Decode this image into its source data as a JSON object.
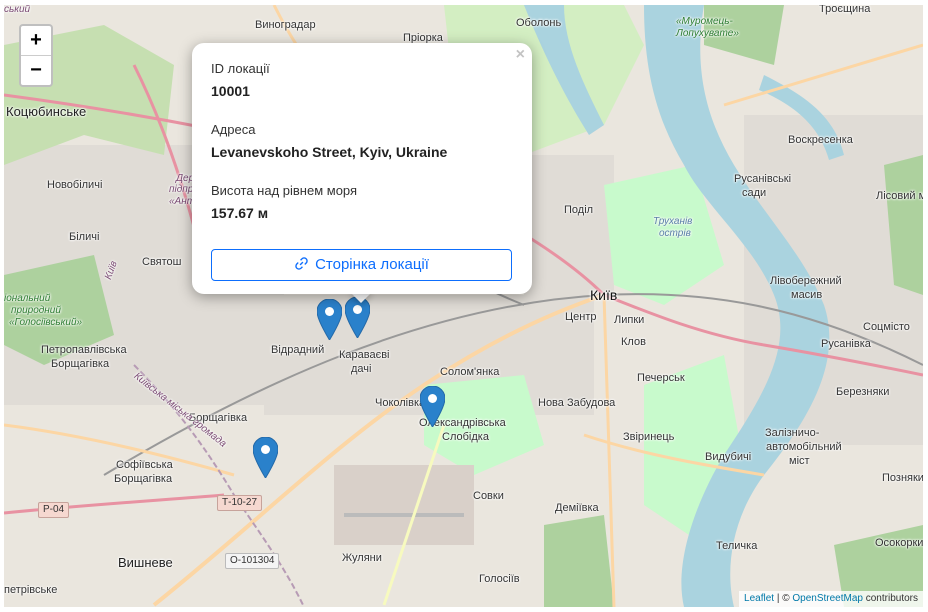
{
  "zoom": {
    "in_label": "+",
    "out_label": "−"
  },
  "popup": {
    "close_label": "×",
    "id_label": "ID локації",
    "id_value": "10001",
    "address_label": "Адреса",
    "address_value": "Levanevskoho Street, Kyiv, Ukraine",
    "elevation_label": "Висота над рівнем моря",
    "elevation_value": "157.67 м",
    "link_label": "Сторінка локації",
    "link_icon": "link-icon"
  },
  "attribution": {
    "leaflet": "Leaflet",
    "separator": " | © ",
    "osm": "OpenStreetMap",
    "suffix": " contributors"
  },
  "map_labels": [
    {
      "text": "ський",
      "cls": "lbl purple"
    },
    {
      "text": "Виноградар"
    },
    {
      "text": "Оболонь"
    },
    {
      "text": "«Муромець-",
      "cls": "lbl green"
    },
    {
      "text": "Лопухувате»",
      "cls": "lbl green"
    },
    {
      "text": "Троєщина"
    },
    {
      "text": "Пріорка"
    },
    {
      "text": "Коцюбинське",
      "cls": "lbl big"
    },
    {
      "text": "Воскресенка"
    },
    {
      "text": "Новобіличі"
    },
    {
      "text": "Русанівські"
    },
    {
      "text": "сади"
    },
    {
      "text": "Лісовий м"
    },
    {
      "text": "Держ",
      "cls": "lbl purple"
    },
    {
      "text": "підпри",
      "cls": "lbl purple"
    },
    {
      "text": "«Анто",
      "cls": "lbl purple"
    },
    {
      "text": "Поділ"
    },
    {
      "text": "Труханів",
      "cls": "lbl water"
    },
    {
      "text": "острів",
      "cls": "lbl water"
    },
    {
      "text": "Біличі"
    },
    {
      "text": "Святош"
    },
    {
      "text": "Київ",
      "cls": "lbl city"
    },
    {
      "text": "Лівобережний"
    },
    {
      "text": "масив"
    },
    {
      "text": "іональний",
      "cls": "lbl green"
    },
    {
      "text": "природний",
      "cls": "lbl green"
    },
    {
      "text": "«Голосіївський»",
      "cls": "lbl green"
    },
    {
      "text": "Центр"
    },
    {
      "text": "Липки"
    },
    {
      "text": "Соцмісто"
    },
    {
      "text": "Петропавлівська"
    },
    {
      "text": "Борщагівка"
    },
    {
      "text": "Відрадний"
    },
    {
      "text": "Караваєві"
    },
    {
      "text": "дачі"
    },
    {
      "text": "Клов"
    },
    {
      "text": "Русанівка"
    },
    {
      "text": "Солом'янка"
    },
    {
      "text": "Печерськ"
    },
    {
      "text": "Березняки"
    },
    {
      "text": "Чоколівка"
    },
    {
      "text": "Нова Забудова"
    },
    {
      "text": "Борщагівка"
    },
    {
      "text": "Олександрівська"
    },
    {
      "text": "Слобідка"
    },
    {
      "text": "Звіринець"
    },
    {
      "text": "Залізничо-"
    },
    {
      "text": "автомобільний"
    },
    {
      "text": "міст"
    },
    {
      "text": "Видубичі"
    },
    {
      "text": "Софіївська"
    },
    {
      "text": "Борщагівка"
    },
    {
      "text": "Позняки"
    },
    {
      "text": "Совки"
    },
    {
      "text": "Деміївка"
    },
    {
      "text": "Осокорки"
    },
    {
      "text": "Теличка"
    },
    {
      "text": "Жуляни"
    },
    {
      "text": "Вишневе",
      "cls": "lbl big"
    },
    {
      "text": "Голосіїв"
    },
    {
      "text": "петрівське"
    },
    {
      "text": "Київська міська громада",
      "cls": "lbl purple"
    },
    {
      "text": "Київ",
      "cls": "lbl purple"
    }
  ],
  "shields": [
    "Р-04",
    "Т-10-27",
    "О-101304"
  ],
  "markers": [
    {
      "name": "location-marker"
    },
    {
      "name": "location-marker"
    },
    {
      "name": "location-marker"
    },
    {
      "name": "location-marker"
    }
  ],
  "colors": {
    "marker": "#2a81cb",
    "water": "#aad3df",
    "park": "#c8facc",
    "motorway": "#e892a2",
    "primary": "#fcd6a4",
    "button": "#0d6efd"
  }
}
